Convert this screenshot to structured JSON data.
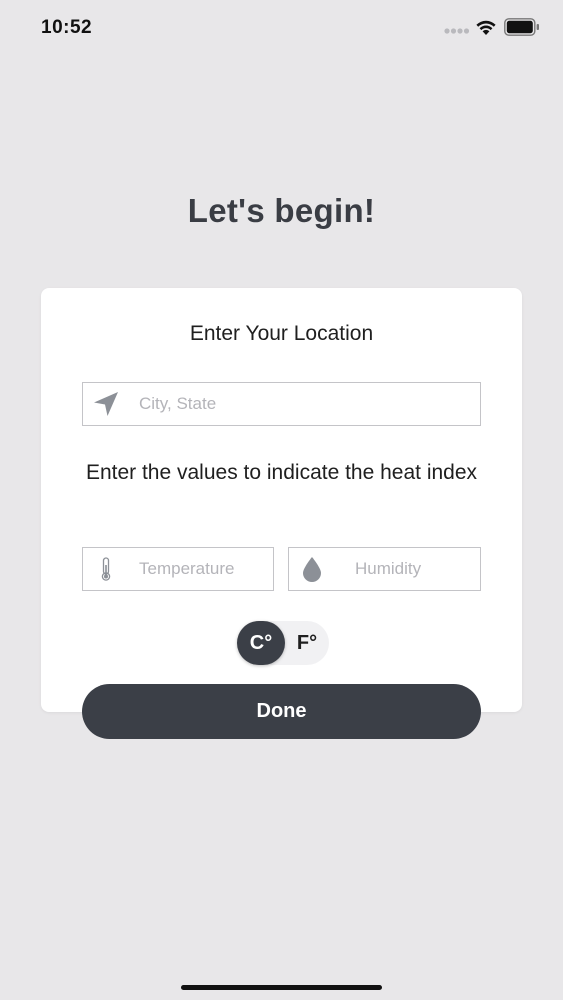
{
  "status_bar": {
    "time": "10:52"
  },
  "title": "Let's begin!",
  "card": {
    "location_heading": "Enter Your Location",
    "location_placeholder": "City, State",
    "heat_index_heading": "Enter the values to indicate the heat index",
    "temperature_placeholder": "Temperature",
    "humidity_placeholder": "Humidity",
    "unit_toggle": {
      "selected": "C°",
      "other": "F°"
    }
  },
  "done_label": "Done",
  "colors": {
    "background": "#e8e7e9",
    "card": "#ffffff",
    "accent_dark": "#3b3f47",
    "placeholder": "#b4b4b9",
    "icon_gray": "#8c9097"
  },
  "icons": {
    "location": "navigation-arrow-icon",
    "temperature": "thermometer-icon",
    "humidity": "water-drop-icon"
  }
}
